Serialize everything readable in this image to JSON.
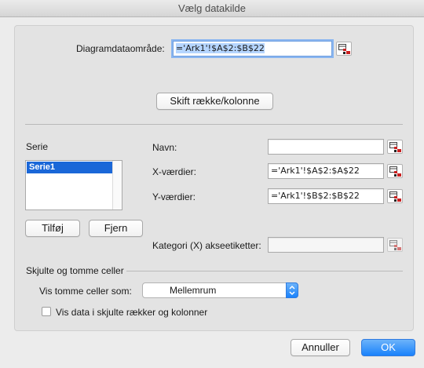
{
  "window": {
    "title": "Vælg datakilde"
  },
  "range": {
    "label": "Diagramdataområde:",
    "value": "='Ark1'!$A$2:$B$22"
  },
  "switch_button": "Skift række/kolonne",
  "series": {
    "header": "Serie",
    "items": [
      "Serie1"
    ],
    "add_button": "Tilføj",
    "remove_button": "Fjern"
  },
  "fields": {
    "name_label": "Navn:",
    "name_value": "",
    "x_label": "X-værdier:",
    "x_value": "='Ark1'!$A$2:$A$22",
    "y_label": "Y-værdier:",
    "y_value": "='Ark1'!$B$2:$B$22",
    "category_label": "Kategori (X) akseetiketter:",
    "category_value": ""
  },
  "hidden_cells": {
    "header": "Skjulte og tomme celler",
    "empty_label": "Vis tomme celler som:",
    "empty_value": "Mellemrum",
    "checkbox_label": "Vis data i skjulte rækker og kolonner",
    "checkbox_checked": false
  },
  "footer": {
    "cancel_label": "Annuller",
    "ok_label": "OK"
  },
  "colors": {
    "accent": "#1a82fb",
    "selection": "#1a67d8"
  }
}
